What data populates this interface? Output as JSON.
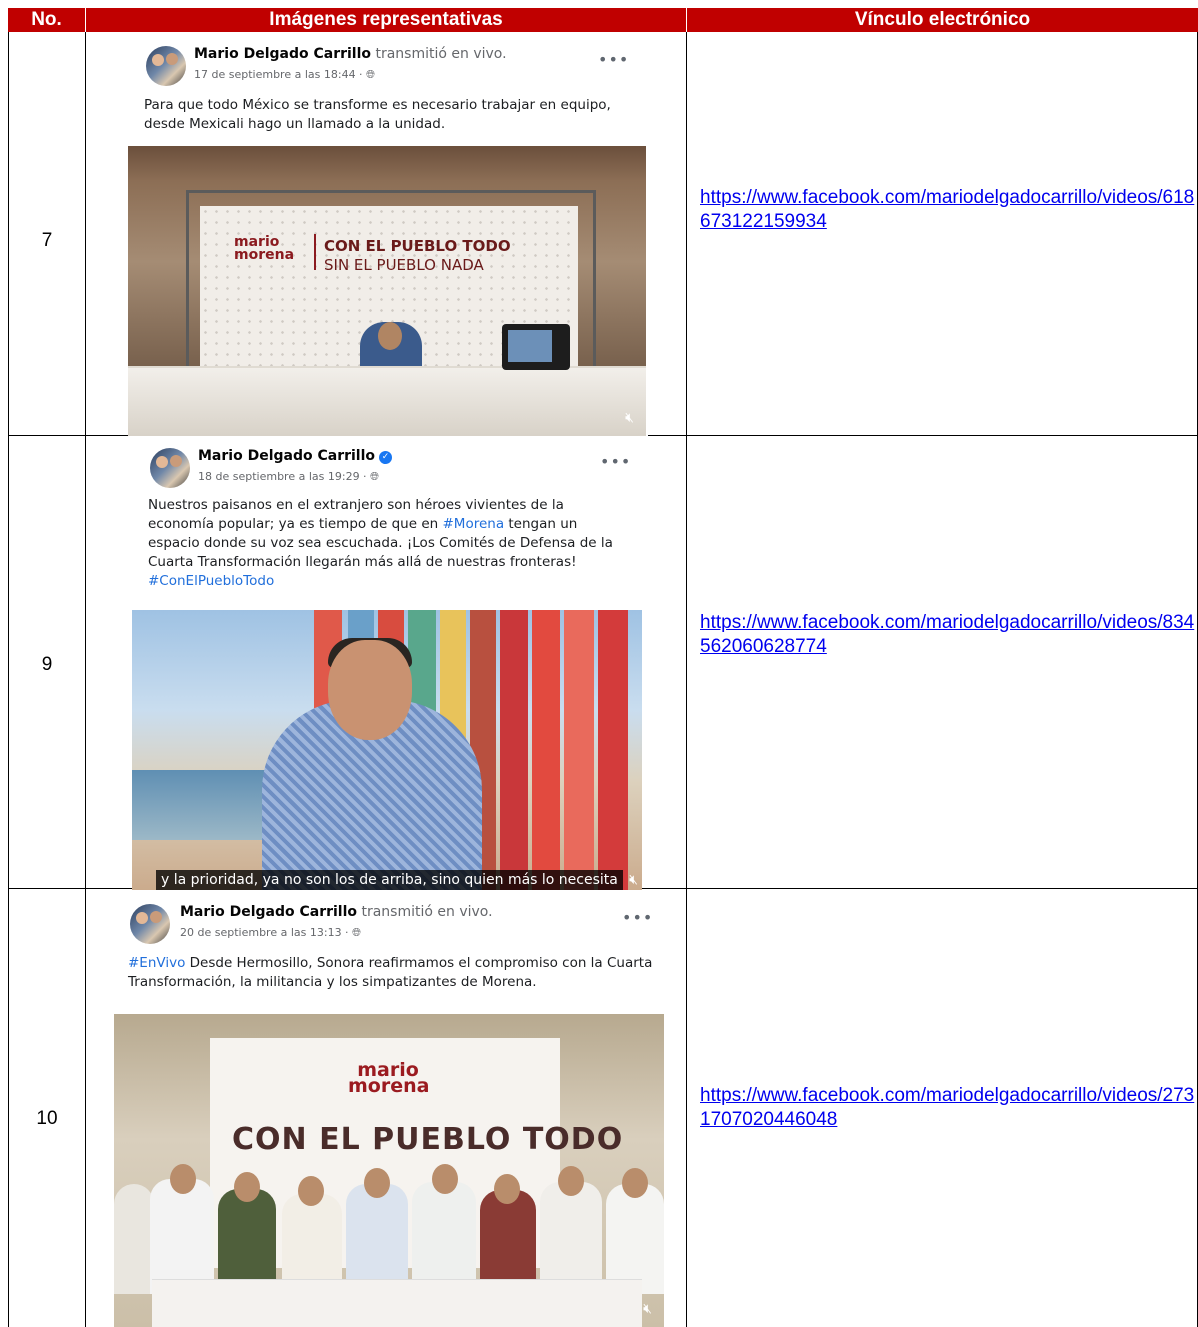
{
  "headers": {
    "no": "No.",
    "images": "Imágenes representativas",
    "link": "Vínculo electrónico"
  },
  "rows": [
    {
      "no": "7",
      "post": {
        "author": "Mario Delgado Carrillo",
        "action": "transmitió en vivo.",
        "date": "17 de septiembre a las 18:44 ·",
        "text": "Para que todo México se transforme es necesario trabajar en equipo, desde Mexicali hago un llamado a la unidad.",
        "video_brand": "mario morena",
        "video_slogan_1": "CON EL PUEBLO TODO",
        "video_slogan_2": "SIN EL PUEBLO NADA"
      },
      "link": "https://www.facebook.com/mariodelgadocarrillo/videos/618673122159934"
    },
    {
      "no": "9",
      "post": {
        "author": "Mario Delgado Carrillo",
        "date": "18 de septiembre a las 19:29 ·",
        "text_before_tag": "Nuestros paisanos en el extranjero son héroes vivientes de la economía popular; ya es tiempo de que en ",
        "tag1": "#Morena",
        "text_after_tag": " tengan un espacio donde su voz sea escuchada. ¡Los Comités de Defensa de la Cuarta Transformación llegarán más allá de nuestras fronteras!",
        "tag2": "#ConElPuebloTodo",
        "caption": "y la prioridad, ya no son los de arriba, sino quien más lo necesita"
      },
      "link": "https://www.facebook.com/mariodelgadocarrillo/videos/834562060628774"
    },
    {
      "no": "10",
      "post": {
        "author": "Mario Delgado Carrillo",
        "action": "transmitió en vivo.",
        "date": "20 de septiembre a las 13:13 ·",
        "tag": "#EnVivo",
        "text": " Desde Hermosillo, Sonora reafirmamos el compromiso con la Cuarta Transformación, la militancia y los simpatizantes de Morena.",
        "video_brand": "mario morena",
        "video_slogan": "CON EL PUEBLO TODO"
      },
      "link": "https://www.facebook.com/mariodelgadocarrillo/videos/2731707020446048"
    }
  ],
  "colors": {
    "header_bg": "#c00000",
    "link": "#0000ee",
    "hashtag": "#216fdb"
  }
}
